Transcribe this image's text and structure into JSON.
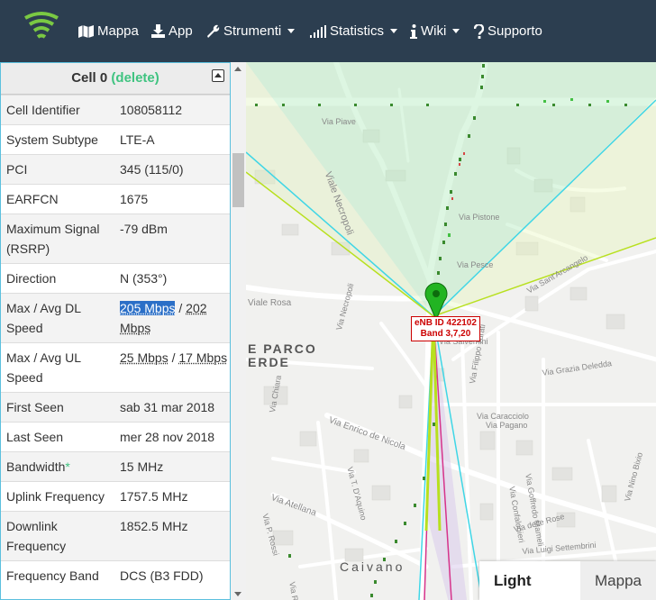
{
  "nav": {
    "items": [
      {
        "label": "Mappa",
        "icon": "map-icon",
        "dropdown": false
      },
      {
        "label": "App",
        "icon": "download-icon",
        "dropdown": false
      },
      {
        "label": "Strumenti",
        "icon": "wrench-icon",
        "dropdown": true
      },
      {
        "label": "Statistics",
        "icon": "signal-bars-icon",
        "dropdown": true
      },
      {
        "label": "Wiki",
        "icon": "info-icon",
        "dropdown": true
      },
      {
        "label": "Supporto",
        "icon": "question-icon",
        "dropdown": false
      }
    ]
  },
  "panel": {
    "title": "Cell 0",
    "delete_label": "(delete)",
    "rows": [
      {
        "key": "Cell Identifier",
        "value": "108058112"
      },
      {
        "key": "System Subtype",
        "value": "LTE-A"
      },
      {
        "key": "PCI",
        "value": "345 (115/0)"
      },
      {
        "key": "EARFCN",
        "value": "1675"
      },
      {
        "key": "Maximum Signal (RSRP)",
        "value": "-79 dBm"
      },
      {
        "key": "Direction",
        "value": "N (353°)"
      },
      {
        "key": "Max / Avg DL Speed",
        "max": "205 Mbps",
        "sep": " / ",
        "avg": "202 Mbps"
      },
      {
        "key": "Max / Avg UL Speed",
        "max": "25 Mbps",
        "sep": " / ",
        "avg": "17 Mbps"
      },
      {
        "key": "First Seen",
        "value": "sab 31 mar 2018"
      },
      {
        "key": "Last Seen",
        "value": "mer 28 nov 2018"
      },
      {
        "key": "Bandwidth",
        "asterisk": "*",
        "value": "15 MHz"
      },
      {
        "key": "Uplink Frequency",
        "value": "1757.5 MHz"
      },
      {
        "key": "Downlink Frequency",
        "value": "1852.5 MHz"
      },
      {
        "key": "Frequency Band",
        "value": "DCS (B3 FDD)"
      }
    ]
  },
  "map": {
    "streets": [
      "Via Piave",
      "Viale Necropoli",
      "Via Pistone",
      "Via Pesce",
      "Viale Rosa",
      "Via Sant'Arcangelo",
      "Via Necropoli",
      "Via Salvemini",
      "Via Filippo Turati",
      "Via Grazia Deledda",
      "Via Enrico de Nicola",
      "Via Pagano",
      "Via Caracciolo",
      "Via T. D'Aquino",
      "Via Atellana",
      "Via P. Rossi",
      "Via Chiara",
      "Via Goffredo Mameli",
      "Via Confalonieri",
      "Via delle Rose",
      "Via Nino Bixio",
      "Via Luigi Settembrini",
      "Via Roma"
    ],
    "park_label_1": "E PARCO",
    "park_label_2": "ERDE",
    "town": "Caivano",
    "enb_line1": "eNB ID 422102",
    "enb_line2": "Band 3,7,20",
    "toggle_active": "Light Map",
    "toggle_other": "Mappa"
  },
  "colors": {
    "navbar": "#2c3e50",
    "accent_green": "#3fc380",
    "marker_green": "#22b422",
    "cell_line_cyan": "#3fd6e6",
    "cell_line_lime": "#b8e01f",
    "cell_line_pink": "#d6338b",
    "selection": "#2b6fc7"
  }
}
